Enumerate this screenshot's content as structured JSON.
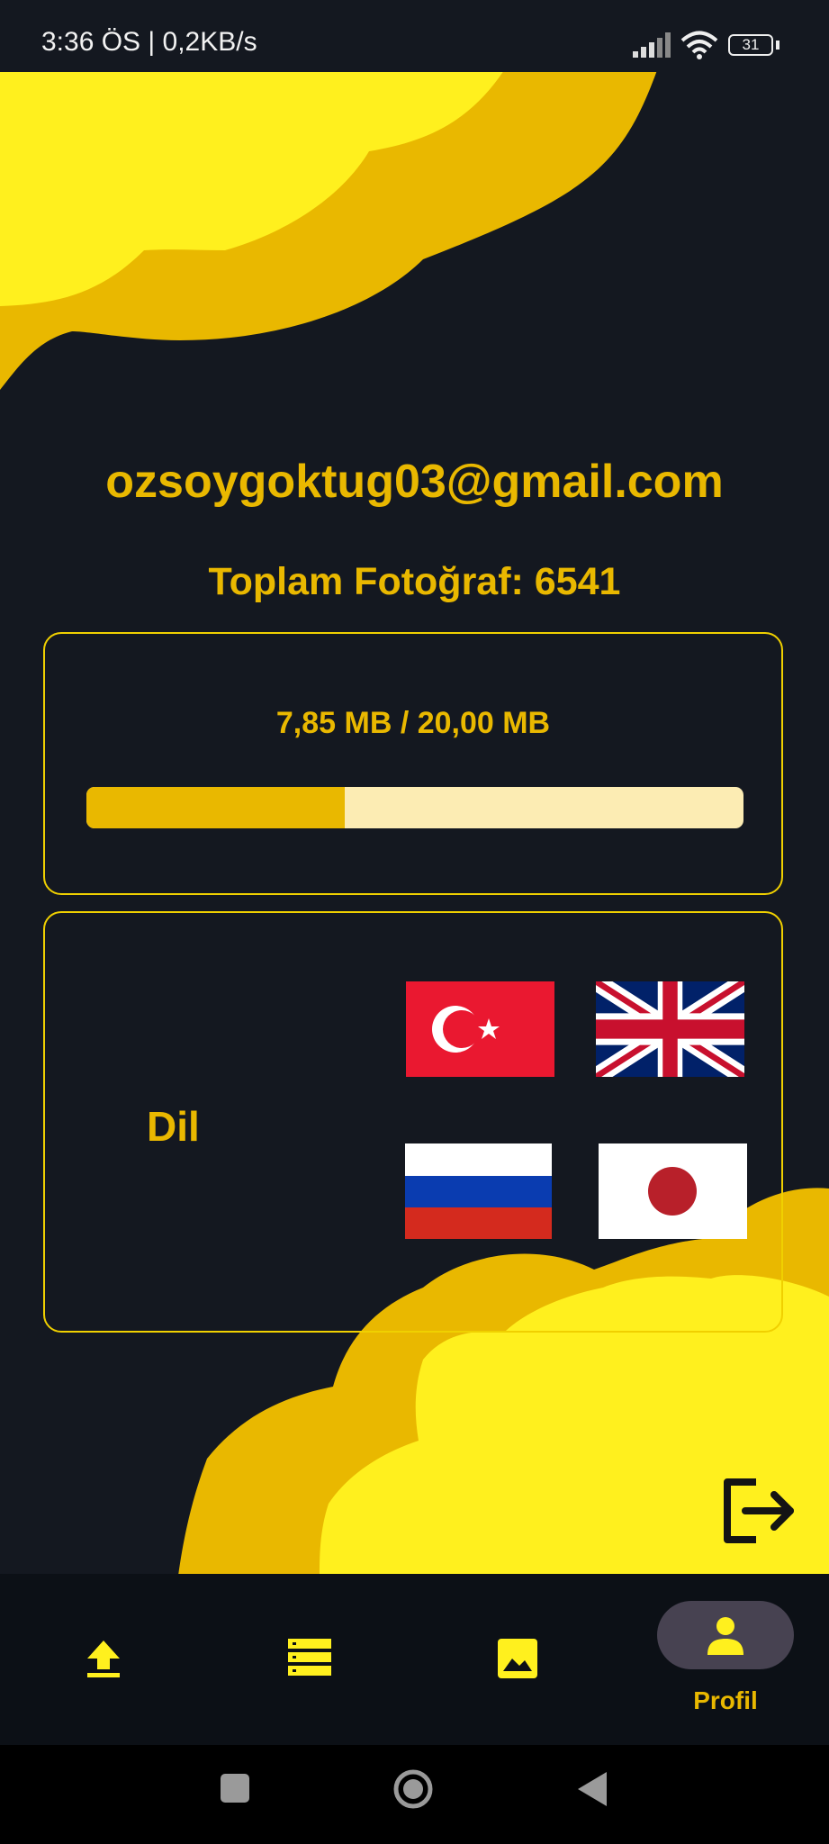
{
  "status_bar": {
    "time_speed": "3:36 ÖS | 0,2KB/s",
    "battery_level": "31"
  },
  "profile": {
    "email": "ozsoygoktug03@gmail.com",
    "total_photos": "Toplam Fotoğraf: 6541"
  },
  "storage": {
    "usage_text": "7,85 MB / 20,00 MB",
    "used_mb": 7.85,
    "total_mb": 20.0
  },
  "language": {
    "label": "Dil",
    "flags": [
      "turkish-flag",
      "british-flag",
      "russian-flag",
      "japanese-flag"
    ]
  },
  "navigation": {
    "items": [
      "upload-icon",
      "list-icon",
      "gallery-icon",
      "person-icon"
    ],
    "active_label": "Profil"
  },
  "colors": {
    "accent": "#e9b800",
    "background": "#141820",
    "cloud_light": "#fff01e",
    "progress_track": "#fcecb3"
  }
}
